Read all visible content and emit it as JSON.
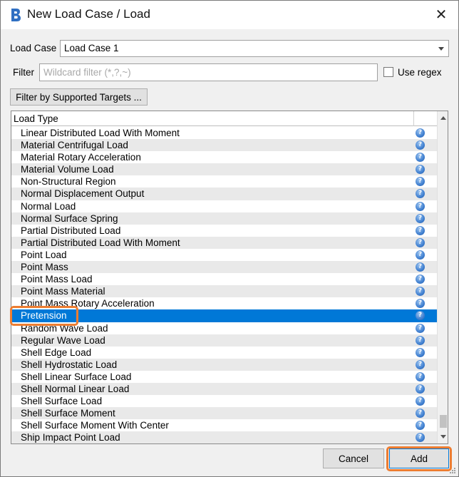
{
  "window": {
    "title": "New Load Case / Load",
    "close_glyph": "✕",
    "app_icon": "app-logo-icon"
  },
  "load_case": {
    "label": "Load Case",
    "selected": "Load Case 1"
  },
  "filter": {
    "label": "Filter",
    "value": "",
    "placeholder": "Wildcard filter (*,?,~)",
    "use_regex_label": "Use regex",
    "use_regex_checked": false
  },
  "filter_targets_button": "Filter by Supported Targets ...",
  "table": {
    "header": "Load Type",
    "selected_index": 15,
    "help_icon": "help-icon",
    "rows": [
      "Linear Distributed Load With Moment",
      "Material Centrifugal Load",
      "Material Rotary Acceleration",
      "Material Volume Load",
      "Non-Structural Region",
      "Normal Displacement Output",
      "Normal Load",
      "Normal Surface Spring",
      "Partial Distributed Load",
      "Partial Distributed Load With Moment",
      "Point Load",
      "Point Mass",
      "Point Mass Load",
      "Point Mass Material",
      "Point Mass Rotary Acceleration",
      "Pretension",
      "Random Wave Load",
      "Regular Wave Load",
      "Shell Edge Load",
      "Shell Hydrostatic Load",
      "Shell Linear Surface Load",
      "Shell Normal Linear Load",
      "Shell Surface Load",
      "Shell Surface Moment",
      "Shell Surface Moment With Center",
      "Ship Impact Point Load"
    ]
  },
  "buttons": {
    "cancel": "Cancel",
    "add": "Add"
  },
  "colors": {
    "selection": "#0078d7",
    "highlight": "#ed7d31"
  }
}
